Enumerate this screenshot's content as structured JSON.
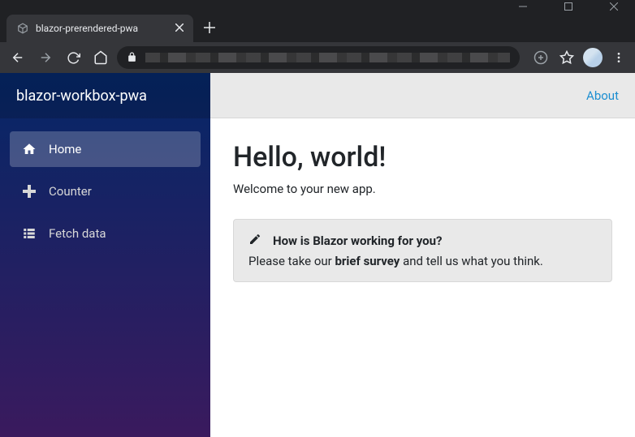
{
  "browser": {
    "tab_title": "blazor-prerendered-pwa"
  },
  "sidebar": {
    "brand": "blazor-workbox-pwa",
    "items": [
      {
        "label": "Home"
      },
      {
        "label": "Counter"
      },
      {
        "label": "Fetch data"
      }
    ]
  },
  "topbar": {
    "about_label": "About"
  },
  "page": {
    "heading": "Hello, world!",
    "subtext": "Welcome to your new app."
  },
  "alert": {
    "title": "How is Blazor working for you?",
    "body_prefix": "Please take our ",
    "body_strong": "brief survey",
    "body_suffix": " and tell us what you think."
  }
}
